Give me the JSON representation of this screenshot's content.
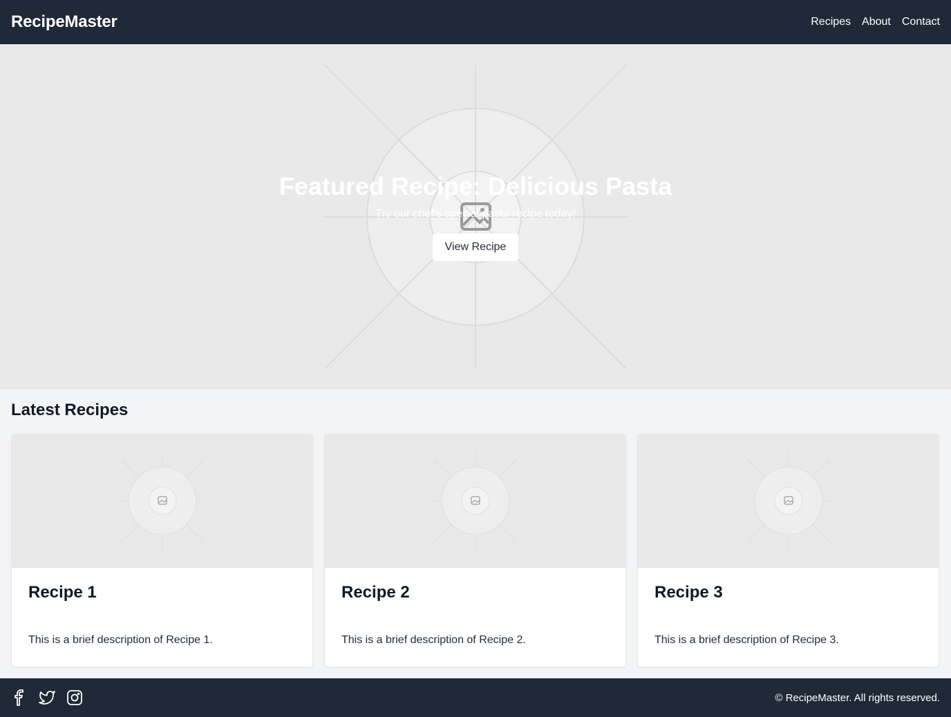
{
  "header": {
    "brand": "RecipeMaster",
    "nav": [
      "Recipes",
      "About",
      "Contact"
    ]
  },
  "hero": {
    "title": "Featured Recipe: Delicious Pasta",
    "subtitle": "Try our chef's special pasta recipe today!",
    "button_label": "View Recipe",
    "image_icon": "image-placeholder-icon"
  },
  "latest": {
    "title": "Latest Recipes",
    "cards": [
      {
        "title": "Recipe 1",
        "description": "This is a brief description of Recipe 1."
      },
      {
        "title": "Recipe 2",
        "description": "This is a brief description of Recipe 2."
      },
      {
        "title": "Recipe 3",
        "description": "This is a brief description of Recipe 3."
      }
    ]
  },
  "footer": {
    "socials": [
      "facebook-icon",
      "twitter-icon",
      "instagram-icon"
    ],
    "copyright": "© RecipeMaster. All rights reserved."
  },
  "colors": {
    "header_bg": "#1f2937",
    "page_bg": "#f3f4f6",
    "placeholder_bg": "#e9e9e9"
  }
}
